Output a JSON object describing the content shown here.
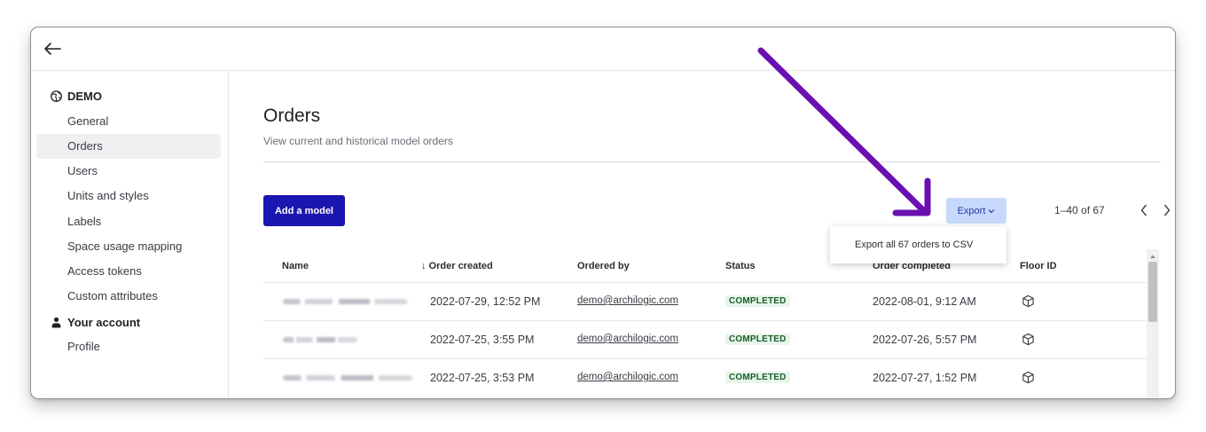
{
  "sidebar": {
    "group_demo": "DEMO",
    "items_demo": [
      {
        "label": "General"
      },
      {
        "label": "Orders"
      },
      {
        "label": "Users"
      },
      {
        "label": "Units and styles"
      },
      {
        "label": "Labels"
      },
      {
        "label": "Space usage mapping"
      },
      {
        "label": "Access tokens"
      },
      {
        "label": "Custom attributes"
      }
    ],
    "group_account": "Your account",
    "items_account": [
      {
        "label": "Profile"
      }
    ]
  },
  "main": {
    "title": "Orders",
    "subtitle": "View current and historical model orders",
    "add_button": "Add a model",
    "export_button": "Export",
    "pager": "1–40 of 67",
    "dropdown_item": "Export all 67 orders to CSV",
    "columns": {
      "name": "Name",
      "created": "↓ Order created",
      "ordered_by": "Ordered by",
      "status": "Status",
      "completed": "Order completed",
      "floor": "Floor ID"
    },
    "rows": [
      {
        "created": "2022-07-29, 12:52 PM",
        "ordered_by": "demo@archilogic.com",
        "status": "COMPLETED",
        "completed": "2022-08-01, 9:12 AM"
      },
      {
        "created": "2022-07-25, 3:55 PM",
        "ordered_by": "demo@archilogic.com",
        "status": "COMPLETED",
        "completed": "2022-07-26, 5:57 PM"
      },
      {
        "created": "2022-07-25, 3:53 PM",
        "ordered_by": "demo@archilogic.com",
        "status": "COMPLETED",
        "completed": "2022-07-27, 1:52 PM"
      }
    ]
  },
  "colors": {
    "primary": "#1c16b0",
    "export_bg": "#c7d9fb",
    "annotation_arrow": "#6a0fb0",
    "badge_bg": "#e7f5ea"
  },
  "icons": [
    "back-arrow-icon",
    "globe-icon",
    "person-icon",
    "chevron-down-icon",
    "chevron-left-icon",
    "chevron-right-icon",
    "cube-icon",
    "scroll-up-icon"
  ]
}
